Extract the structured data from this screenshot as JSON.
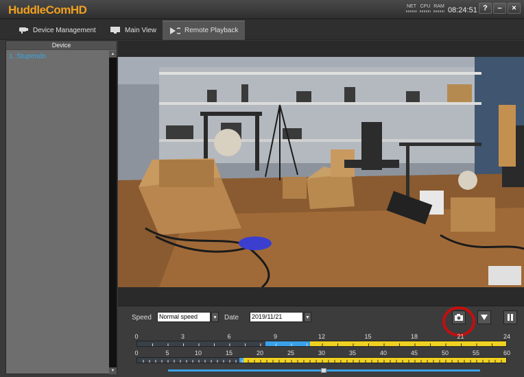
{
  "app": {
    "title": "HuddleComHD",
    "clock": "08:24:51"
  },
  "meters": [
    "NET",
    "CPU",
    "RAM"
  ],
  "window_buttons": {
    "help": "?",
    "minimize": "–",
    "close": "×"
  },
  "tabs": [
    {
      "label": "Device Management",
      "icon": "camera-device-icon"
    },
    {
      "label": "Main View",
      "icon": "monitor-icon"
    },
    {
      "label": "Remote Playback",
      "icon": "playback-icon",
      "active": true
    }
  ],
  "sidebar": {
    "header": "Device",
    "items": [
      {
        "label": "1. Stupendo"
      }
    ]
  },
  "controls": {
    "speed_label": "Speed",
    "speed_value": "Normal speed",
    "date_label": "Date",
    "date_value": "2019/11/21",
    "snapshot_icon": "camera-icon",
    "download_icon": "down-arrow-icon",
    "pause_icon": "pause-icon",
    "highlight_color": "#c40e0e"
  },
  "timeline_hours": {
    "labels": [
      "0",
      "3",
      "6",
      "9",
      "12",
      "15",
      "18",
      "21",
      "24"
    ],
    "current_hour": 8.3,
    "recording_start_hour": 11.2,
    "recording_end_hour": 24
  },
  "timeline_minutes": {
    "labels": [
      "0",
      "5",
      "10",
      "15",
      "20",
      "25",
      "30",
      "35",
      "40",
      "45",
      "50",
      "55",
      "60"
    ],
    "current_minute": 16.5,
    "recording_start_minute": 17.2,
    "recording_end_minute": 60
  },
  "colors": {
    "accent": "#f0a020",
    "timeline_recording": "#f0d020",
    "timeline_current": "#3aa0e8",
    "device_link": "#3aa8e0"
  }
}
